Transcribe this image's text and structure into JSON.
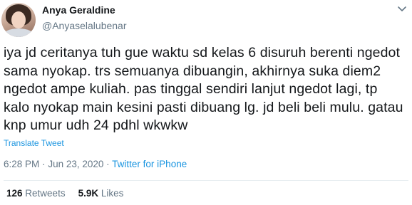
{
  "user": {
    "name": "Anya Geraldine",
    "handle": "@Anyaselalubenar"
  },
  "tweet": {
    "lines": [
      "iya jd ceritanya tuh gue waktu sd kelas 6 disuruh berenti ngedot",
      "sama nyokap. trs semuanya dibuangin, akhirnya suka diem2",
      "ngedot ampe kuliah. pas tinggal sendiri lanjut ngedot lagi, tp",
      "kalo nyokap main kesini pasti dibuang lg. jd beli beli mulu. gatau",
      "knp umur udh 24 pdhl wkwkw"
    ],
    "translate_label": "Translate Tweet",
    "time": "6:28 PM",
    "separator": "·",
    "date": "Jun 23, 2020",
    "source": "Twitter for iPhone"
  },
  "stats": {
    "retweets_count": "126",
    "retweets_label": "Retweets",
    "likes_count": "5.9K",
    "likes_label": "Likes"
  },
  "icons": {
    "menu": "chevron-down-icon"
  },
  "colors": {
    "link": "#1b95e0",
    "secondary_text": "#657786",
    "primary_text": "#14171a"
  }
}
